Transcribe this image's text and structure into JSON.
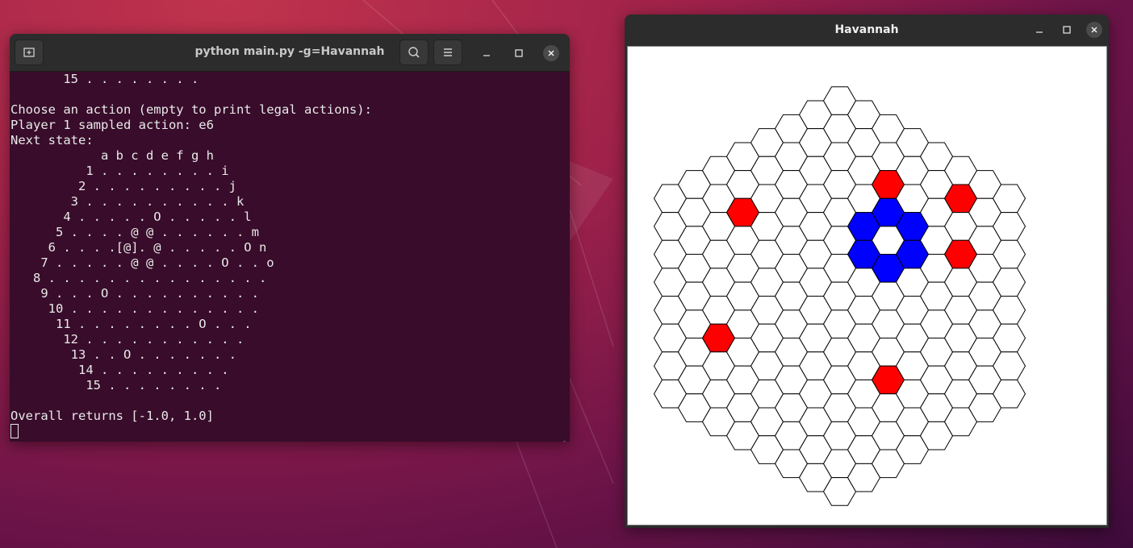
{
  "terminal": {
    "title": "python main.py -g=Havannah",
    "lines": [
      "       15 . . . . . . . .",
      "",
      "Choose an action (empty to print legal actions):",
      "Player 1 sampled action: e6",
      "Next state:",
      "            a b c d e f g h",
      "          1 . . . . . . . . i",
      "         2 . . . . . . . . . j",
      "        3 . . . . . . . . . . k",
      "       4 . . . . . O . . . . . l",
      "      5 . . . . @ @ . . . . . . m",
      "     6 . . . .[@]. @ . . . . . O n",
      "    7 . . . . . @ @ . . . . O . . o",
      "   8 . . . . . . . . . . . . . . .",
      "    9 . . . O . . . . . . . . . .",
      "     10 . . . . . . . . . . . . .",
      "      11 . . . . . . . . O . . .",
      "       12 . . . . . . . . . . .",
      "        13 . . O . . . . . . .",
      "         14 . . . . . . . . .",
      "          15 . . . . . . . .",
      "",
      "Overall returns [-1.0, 1.0]"
    ]
  },
  "havannah": {
    "title": "Havannah",
    "board_size": 8,
    "colors": {
      "player_blue": "#0000ff",
      "player_red": "#ff0000",
      "empty": "#ffffff",
      "stroke": "#000000"
    },
    "blue_cells": [
      [
        2,
        -4
      ],
      [
        3,
        -4
      ],
      [
        1,
        -3
      ],
      [
        3,
        -3
      ],
      [
        1,
        -2
      ],
      [
        2,
        -2
      ]
    ],
    "red_cells": [
      [
        5,
        -6
      ],
      [
        2,
        -5
      ],
      [
        5,
        -4
      ],
      [
        -4,
        -1
      ],
      [
        2,
        2
      ],
      [
        -5,
        4
      ]
    ]
  },
  "icons": [
    "new-tab-icon",
    "search-icon",
    "menu-icon",
    "minimize-icon",
    "maximize-icon",
    "close-icon"
  ]
}
